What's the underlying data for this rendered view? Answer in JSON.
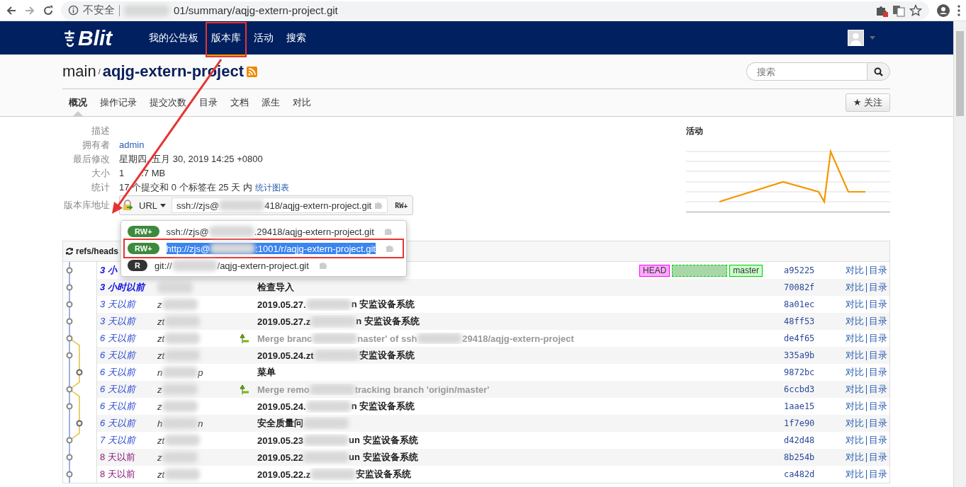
{
  "browser": {
    "security": "不安全",
    "address_parts": [
      {
        "kind": "blur"
      },
      {
        "text": "01/summary/aqjg-extern-project.git"
      }
    ]
  },
  "navbar": {
    "brand": "Blit",
    "items": [
      {
        "label": "我的公告板",
        "selected": false,
        "highlighted": false
      },
      {
        "label": "版本库",
        "selected": true,
        "highlighted": true
      },
      {
        "label": "活动",
        "selected": false,
        "highlighted": false
      },
      {
        "label": "搜索",
        "selected": false,
        "highlighted": false
      }
    ]
  },
  "header": {
    "project_group": "main",
    "separator": "/",
    "project": "aqjg-extern-project",
    "search": {
      "placeholder": "搜索"
    }
  },
  "tabs": [
    {
      "label": "概况",
      "selected": true
    },
    {
      "label": "操作记录",
      "selected": false
    },
    {
      "label": "提交次数",
      "selected": false
    },
    {
      "label": "目录",
      "selected": false
    },
    {
      "label": "文档",
      "selected": false
    },
    {
      "label": "派生",
      "selected": false
    },
    {
      "label": "对比",
      "selected": false
    }
  ],
  "watch_button": {
    "icon": "★",
    "label": "关注"
  },
  "info": [
    {
      "label": "描述"
    },
    {
      "label": "拥有者",
      "value": "admin",
      "kind": "link"
    },
    {
      "label": "最后修改",
      "value": "星期四, 五月 30, 2019 14:25 +0800",
      "kind": "text"
    },
    {
      "label": "大小",
      "value": "1",
      "value_2": ".7 MB",
      "kind": "text"
    },
    {
      "label": "统计",
      "value": "17 个提交和 0 个标签在 25 天 内",
      "link": "统计图表",
      "kind": "text"
    },
    {
      "label": "版本库地址",
      "kind": "url"
    }
  ],
  "url_control": {
    "protocol": "URL",
    "url_parts": [
      {
        "text": "ssh://zjs@"
      },
      {
        "kind": "blur"
      },
      {
        "text": "418/aqjg-extern-project.git"
      }
    ],
    "permission": "RW+",
    "menu": [
      {
        "badge": "RW+",
        "color": "#3d8a3d",
        "url_parts": [
          {
            "text": "ssh://zjs@"
          },
          {
            "kind": "blur"
          },
          {
            "text": ".29418/aqjg-extern-project.git"
          }
        ],
        "selected": false
      },
      {
        "badge": "RW+",
        "color": "#3d8a3d",
        "url_parts": [
          {
            "text": "http://zjs@"
          },
          {
            "kind": "blur"
          },
          {
            "text": ":1001/r/aqjg-extern-project.git"
          }
        ],
        "selected": true
      },
      {
        "badge": "R",
        "color": "#333333",
        "url_parts": [
          {
            "text": "git://"
          },
          {
            "kind": "blur"
          },
          {
            "text": "/aqjg-extern-project.git"
          }
        ],
        "selected": false
      }
    ]
  },
  "activity": {
    "title": "活动"
  },
  "commits": {
    "header": "refs/heads",
    "rows": [
      {
        "age": "3 小",
        "color": "#1010e0",
        "recent": true,
        "italic": true,
        "refs": [
          {
            "kind": "head",
            "name": "HEAD"
          },
          {
            "kind": "redacted"
          },
          {
            "kind": "branch",
            "name": "master"
          }
        ],
        "hash": "a95225",
        "links": [
          "对比",
          "目录"
        ],
        "on_branch": false
      },
      {
        "age": "3 小时以前",
        "color": "#1010e0",
        "recent": true,
        "italic": true,
        "author_parts": [
          {
            "kind": "blur"
          }
        ],
        "kind": "commit",
        "message_parts": [
          {
            "text": "检查导入"
          }
        ],
        "hash": "70082f",
        "links": [
          "对比",
          "目录"
        ],
        "on_branch": false
      },
      {
        "age": "3 天以前",
        "color": "#2a4bd0",
        "recent": false,
        "italic": true,
        "author_parts": [
          {
            "text": "z"
          },
          {
            "kind": "blur"
          }
        ],
        "kind": "commit",
        "message_parts": [
          {
            "text": "2019.05.27."
          },
          {
            "kind": "blur"
          },
          {
            "text": "n 安监设备系统"
          }
        ],
        "hash": "8a01ec",
        "links": [
          "对比",
          "目录"
        ],
        "on_branch": false
      },
      {
        "age": "3 天以前",
        "color": "#2a4bd0",
        "recent": false,
        "italic": true,
        "author_parts": [
          {
            "text": "zt"
          },
          {
            "kind": "blur"
          }
        ],
        "kind": "commit",
        "message_parts": [
          {
            "text": "2019.05.27.z"
          },
          {
            "kind": "blur"
          },
          {
            "text": "n 安监设备系统"
          }
        ],
        "hash": "48ff53",
        "links": [
          "对比",
          "目录"
        ],
        "on_branch": false
      },
      {
        "age": "6 天以前",
        "color": "#2a4bd0",
        "recent": false,
        "italic": true,
        "author_parts": [
          {
            "text": "zt"
          },
          {
            "kind": "blur"
          }
        ],
        "kind": "merge",
        "message_parts": [
          {
            "text": "Merge branc"
          },
          {
            "kind": "blur"
          },
          {
            "text": "naster' of ssh"
          },
          {
            "kind": "blur"
          },
          {
            "text": "29418/aqjg-extern-project"
          }
        ],
        "hash": "de4f65",
        "links": [
          "对比",
          "目录"
        ],
        "on_branch": false
      },
      {
        "age": "6 天以前",
        "color": "#2a4bd0",
        "recent": false,
        "italic": true,
        "author_parts": [
          {
            "text": "zt"
          },
          {
            "kind": "blur"
          }
        ],
        "kind": "commit",
        "message_parts": [
          {
            "text": "2019.05.24.zt"
          },
          {
            "kind": "blur"
          },
          {
            "text": "安监设备系统"
          }
        ],
        "hash": "335a9b",
        "links": [
          "对比",
          "目录"
        ],
        "on_branch": false
      },
      {
        "age": "6 天以前",
        "color": "#2a4bd0",
        "recent": false,
        "italic": true,
        "author_parts": [
          {
            "text": "n"
          },
          {
            "kind": "blur"
          },
          {
            "text": "p"
          }
        ],
        "kind": "commit",
        "message_parts": [
          {
            "text": "菜单"
          }
        ],
        "hash": "9872bc",
        "links": [
          "对比",
          "目录"
        ],
        "on_branch": true
      },
      {
        "age": "6 天以前",
        "color": "#2a4bd0",
        "recent": false,
        "italic": true,
        "author_parts": [
          {
            "text": "z"
          },
          {
            "kind": "blur"
          }
        ],
        "kind": "merge",
        "message_parts": [
          {
            "text": "Merge remo"
          },
          {
            "kind": "blur"
          },
          {
            "text": "tracking branch 'origin/master'"
          }
        ],
        "hash": "6ccbd3",
        "links": [
          "对比",
          "目录"
        ],
        "on_branch": false
      },
      {
        "age": "6 天以前",
        "color": "#2a4bd0",
        "recent": false,
        "italic": true,
        "author_parts": [
          {
            "text": "z"
          },
          {
            "kind": "blur"
          }
        ],
        "kind": "commit",
        "message_parts": [
          {
            "text": "2019.05.24."
          },
          {
            "kind": "blur"
          },
          {
            "text": "n 安监设备系统"
          }
        ],
        "hash": "1aae15",
        "links": [
          "对比",
          "目录"
        ],
        "on_branch": false
      },
      {
        "age": "6 天以前",
        "color": "#2a4bd0",
        "recent": false,
        "italic": true,
        "author_parts": [
          {
            "text": "h"
          },
          {
            "kind": "blur"
          },
          {
            "text": "n"
          }
        ],
        "kind": "commit",
        "message_parts": [
          {
            "text": "安全质量问"
          },
          {
            "kind": "blur"
          }
        ],
        "hash": "1f7e90",
        "links": [
          "对比",
          "目录"
        ],
        "on_branch": true
      },
      {
        "age": "7 天以前",
        "color": "#2a4bd0",
        "recent": false,
        "italic": true,
        "author_parts": [
          {
            "text": "zt"
          },
          {
            "kind": "blur"
          }
        ],
        "kind": "commit",
        "message_parts": [
          {
            "text": "2019.05.23"
          },
          {
            "kind": "blur"
          },
          {
            "text": "un 安监设备系统"
          }
        ],
        "hash": "d42d48",
        "links": [
          "对比",
          "目录"
        ],
        "on_branch": false
      },
      {
        "age": "8 天以前",
        "color": "#8a1a7a",
        "recent": false,
        "italic": false,
        "author_parts": [
          {
            "text": "z"
          },
          {
            "kind": "blur"
          }
        ],
        "kind": "commit",
        "message_parts": [
          {
            "text": "2019.05.22"
          },
          {
            "kind": "blur"
          },
          {
            "text": "un 安监设备系统"
          }
        ],
        "hash": "8b254b",
        "links": [
          "对比",
          "目录"
        ],
        "on_branch": false
      },
      {
        "age": "8 天以前",
        "color": "#8a1a7a",
        "recent": false,
        "italic": false,
        "author_parts": [
          {
            "text": "zt"
          },
          {
            "kind": "blur"
          }
        ],
        "kind": "commit",
        "message_parts": [
          {
            "text": "2019.05.22.z"
          },
          {
            "kind": "blur"
          },
          {
            "text": "安监设备系统"
          }
        ],
        "hash": "ca482d",
        "links": [
          "对比",
          "目录"
        ],
        "on_branch": false
      }
    ]
  }
}
